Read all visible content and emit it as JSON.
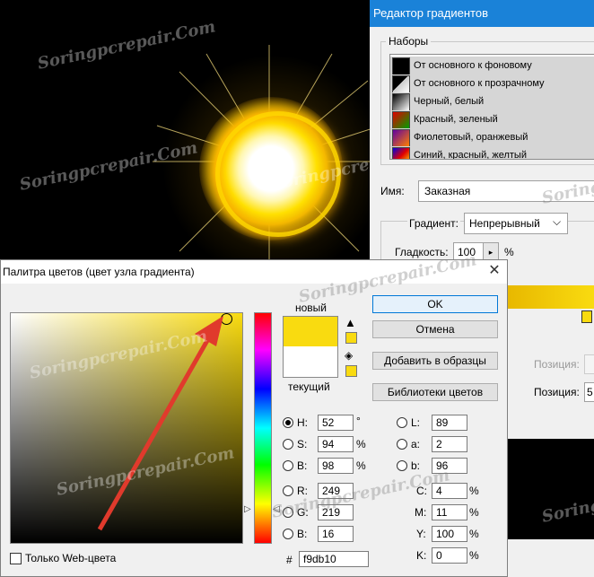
{
  "watermark": "Soringpcrepair.Com",
  "gradient_editor": {
    "title": "Редактор градиентов",
    "presets_legend": "Наборы",
    "presets": [
      {
        "label": "От основного к фоновому",
        "icon": "black-square-icon"
      },
      {
        "label": "От основного к прозрачному",
        "icon": "transparency-gradient-icon"
      },
      {
        "label": "Черный, белый",
        "icon": "black-white-gradient-icon"
      },
      {
        "label": "Красный, зеленый",
        "icon": "red-green-gradient-icon"
      },
      {
        "label": "Фиолетовый, оранжевый",
        "icon": "violet-orange-gradient-icon"
      },
      {
        "label": "Синий, красный, желтый",
        "icon": "blue-red-yellow-gradient-icon"
      }
    ],
    "name_label": "Имя:",
    "name_value": "Заказная",
    "gradient_type_label": "Градиент:",
    "gradient_type_value": "Непрерывный",
    "smoothness_label": "Гладкость:",
    "smoothness_value": "100",
    "smoothness_unit": "%",
    "location_label_disabled": "Позиция:",
    "location_label": "Позиция:",
    "location_value": "5"
  },
  "color_picker": {
    "title": "Палитра цветов (цвет узла градиента)",
    "close_glyph": "✕",
    "new_label": "новый",
    "current_label": "текущий",
    "new_color": "#f9db10",
    "current_color": "#ffffff",
    "buttons": {
      "ok": "OK",
      "cancel": "Отмена",
      "add_to_swatches": "Добавить в образцы",
      "color_libraries": "Библиотеки цветов"
    },
    "hsb": {
      "h_label": "H:",
      "h_value": "52",
      "h_unit": "°",
      "s_label": "S:",
      "s_value": "94",
      "s_unit": "%",
      "b_label": "B:",
      "b_value": "98",
      "b_unit": "%"
    },
    "rgb": {
      "r_label": "R:",
      "r_value": "249",
      "g_label": "G:",
      "g_value": "219",
      "b_label": "B:",
      "b_value": "16"
    },
    "lab": {
      "l_label": "L:",
      "l_value": "89",
      "a_label": "a:",
      "a_value": "2",
      "b_label": "b:",
      "b_value": "96"
    },
    "cmyk": {
      "c_label": "C:",
      "c_value": "4",
      "m_label": "M:",
      "m_value": "11",
      "y_label": "Y:",
      "y_value": "100",
      "k_label": "K:",
      "k_value": "0",
      "unit": "%"
    },
    "hex_label": "#",
    "hex_value": "f9db10",
    "web_colors_label": "Только Web-цвета"
  }
}
